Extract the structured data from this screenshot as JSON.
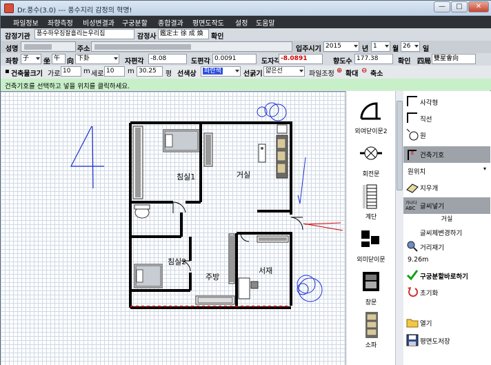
{
  "window": {
    "title": "Dr.풍수(3.0) --- 풍수지리 감정의 혁명!",
    "min": "—",
    "max": "□",
    "close": "✕"
  },
  "menu": [
    "파일정보",
    "좌향측정",
    "비성변결과",
    "구궁분할",
    "종합결과",
    "평면도작도",
    "설정",
    "도움말"
  ],
  "row1": {
    "appraiser_label": "감정기관",
    "appraiser_value": "풍수하우징잘흘리는우리집",
    "appraiser_person_label": "감정사",
    "appraiser_person_value": "鑑定士 徐 成 煥",
    "confirm": "확인"
  },
  "row2": {
    "name_label": "성명",
    "address_label": "주소",
    "move_label": "입주시기",
    "year": "2015",
    "year_unit": "년",
    "month": "1",
    "month_unit": "월",
    "day": "26",
    "day_unit": "일"
  },
  "row3": {
    "jwahyang_label": "좌향",
    "jwa": "子",
    "jwa_char": "坐",
    "hyang": "午",
    "hyang_char": "向",
    "hyang_sub": "下卦",
    "jajeon_label": "자편각",
    "jajeon_value": "-8.08",
    "dopyeon_label": "도편각",
    "dopyeon_value": "0.0091",
    "dojagak_label": "도자각",
    "dojagak_value": "-8.0891",
    "hyangdo_label": "향도수",
    "hyangdo_value": "177.38",
    "confirm": "확인",
    "saguk_label": "四局",
    "saguk_value": "雙星會向"
  },
  "row4": {
    "size_label": "건축물크기",
    "width_label": "가로",
    "width_value": "10",
    "width_unit": "m",
    "height_label": "세로",
    "height_value": "10",
    "height_unit": "m",
    "area_value": "30.25",
    "area_unit": "평",
    "color_label": "선색상",
    "color_value": "파란색",
    "thick_label": "선굵기",
    "thick_value": "얇은선",
    "file_label": "파일조정",
    "zoom_in": "확대",
    "zoom_out": "축소",
    "zoom_in_icon": "plus-circle-icon",
    "zoom_out_icon": "minus-circle-icon"
  },
  "status": "건축기호를 선택하고 넣을 위치를 클릭하세요.",
  "floorplan": {
    "rooms": [
      "침실1",
      "거실",
      "침실2",
      "주방",
      "서재"
    ],
    "compass_digit": "4"
  },
  "palette": [
    {
      "label": "외여닫이문2",
      "icon": "single-door-icon"
    },
    {
      "label": "회전문",
      "icon": "revolving-door-icon"
    },
    {
      "label": "계단",
      "icon": "stairs-icon"
    },
    {
      "label": "외미닫이문",
      "icon": "sliding-door-icon"
    },
    {
      "label": "창문",
      "icon": "window-icon"
    },
    {
      "label": "소파",
      "icon": "sofa-icon"
    }
  ],
  "tools": {
    "rect": "사각형",
    "line": "직선",
    "circle": "원",
    "symbol": "건축기호",
    "place": "원위치",
    "erase": "지우개",
    "text_insert": "글씨넣기",
    "text_value": "거실",
    "text_change": "글씨체변경하기",
    "measure": "거리재기",
    "distance": "9.26m",
    "nine_grid": "구궁분할바로하기",
    "reset": "초기화",
    "open": "열기",
    "save": "평면도저장"
  },
  "colors": {
    "accent_red": "#d00000",
    "line_blue": "#1a2fd0",
    "highlight": "#9ea3aa",
    "status_bg": "#c8f0c8"
  }
}
